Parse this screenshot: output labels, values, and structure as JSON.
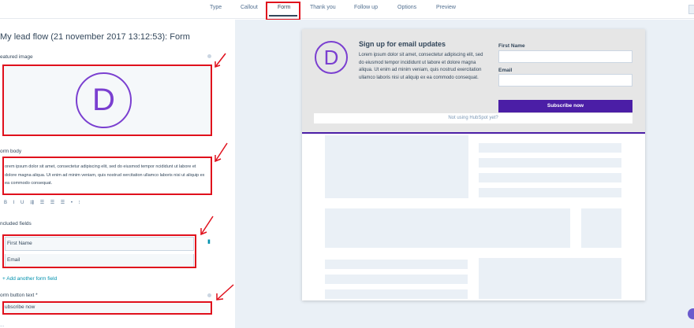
{
  "nav": {
    "tabs": [
      {
        "label": "Type"
      },
      {
        "label": "Callout"
      },
      {
        "label": "Form"
      },
      {
        "label": "Thank you"
      },
      {
        "label": "Follow up"
      },
      {
        "label": "Options"
      },
      {
        "label": "Preview"
      }
    ],
    "active_tab": "Form"
  },
  "editor": {
    "title": "My lead flow (21 november 2017 13:12:53): Form",
    "featured_image_label": "eatured image",
    "logo_letter": "D",
    "form_body_label": "orm body",
    "form_body_text": "orem ipsum dolor sit amet, consectetur adipiscing elit, sed do eiusmod tempor ncididunt ut labore et dolore magna aliqua. Ut enim ad minim veniam, quis nostrud xercitation ullamco laboris nisi ut aliquip ex ea commodo consequat.",
    "toolbar_glyphs": "B I U ⇶ ☰ ☰ ☰ • ⁝",
    "included_fields_label": "ncluded fields",
    "fields": [
      {
        "label": "First Name"
      },
      {
        "label": "Email"
      }
    ],
    "add_field_label": "+ Add another form field",
    "button_text_label": "orm button text *",
    "button_text_value": "ubscribe now",
    "bottom_cutoff_label": "..."
  },
  "preview": {
    "heading": "Sign up for email updates",
    "body": "Lorem ipsum dolor sit amet, consectetur adipiscing elit, sed do eiusmod tempor incididunt ut labore et dolore magna aliqua. Ut enim ad minim veniam, quis nostrud exercitation ullamco laboris nisi ut aliquip ex ea commodo consequat.",
    "logo_letter": "D",
    "first_name_label": "First Name",
    "email_label": "Email",
    "submit_label": "Subscribe now",
    "not_using": "Not using HubSpot yet?"
  },
  "colors": {
    "accent": "#4b1ea6",
    "logo": "#7a3fd0",
    "highlight": "#e0101c",
    "canvas": "#eaf0f6"
  }
}
